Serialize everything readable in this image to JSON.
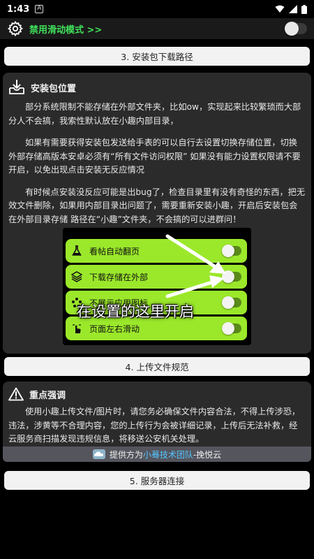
{
  "status_bar": {
    "time": "1:43",
    "notif_letter": "A"
  },
  "top_toggle": {
    "label": "禁用滑动模式 >>",
    "enabled": false
  },
  "sections": {
    "s3": "3. 安装包下载路径",
    "s4": "4. 上传文件规范",
    "s5": "5. 服务器连接"
  },
  "install_card": {
    "title": "安装包位置",
    "paragraphs": [
      "部分系统限制不能存储在外部文件夹，比如ow，实现起来比较繁琐而大部分人不会搞，我索性默认放在小趣内部目录，",
      "如果有需要获得安装包发送给手表的可以自行去设置切换存储位置，切换外部存储高版本安卓必须有“所有文件访问权限” 如果没有能力设置权限请不要开启，以免出现点击安装无反应情况",
      "有时候点安装没反应可能是出bug了，检查目录里有没有奇怪的东西，把无效文件删除，如果用内部目录出问题了，需要重新安装小趣，开启后安装包会在外部目录存储 路径在“小趣”文件夹，不会搞的可以进群问！"
    ],
    "screenshot": {
      "items": [
        {
          "label": "看帖自动翻页"
        },
        {
          "label": "下载存储在外部"
        },
        {
          "label": "不展示应用图标"
        },
        {
          "label": "页面左右滑动"
        }
      ],
      "overlay": "在设置的这里开启"
    }
  },
  "warning_card": {
    "title": "重点强调",
    "text": "使用小趣上传文件/图片时，请您务必确保文件内容合法，不得上传涉恐，违法，涉黄等不合理内容，您的上传行为会被详细记录，上传后无法补救，经云服务商扫描发现违规信息，将移送公安机关处理。"
  },
  "provider": {
    "prefix": "提供方为",
    "team": "小蓦技术团队",
    "suffix": "-挽悦云"
  },
  "colors": {
    "accent_green": "#3fe05a",
    "item_green": "#9be82b",
    "link_blue": "#55c7ff"
  }
}
